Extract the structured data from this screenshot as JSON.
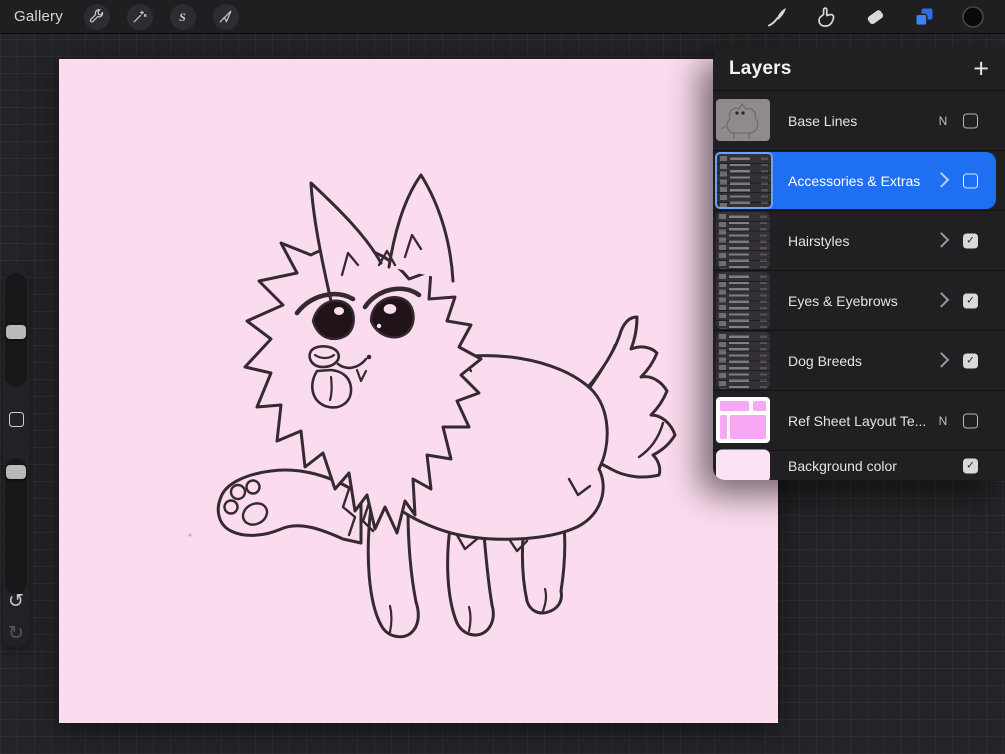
{
  "toolbar": {
    "gallery_label": "Gallery",
    "selection_glyph": "S",
    "icons_left": [
      "wrench-icon",
      "magic-wand-icon",
      "selection-icon",
      "transform-icon"
    ],
    "icons_right": [
      "brush-icon",
      "smudge-icon",
      "eraser-icon",
      "layers-icon",
      "color-swatch"
    ],
    "layers_icon_active_color": "#3c82f8",
    "color_swatch_color": "#0a0a0a"
  },
  "side_controls": {
    "undo_glyph": "↺",
    "redo_glyph": "↻"
  },
  "layers_panel": {
    "title": "Layers",
    "add_button_glyph": "+",
    "selection_color": "#1f6ff2",
    "rows": [
      {
        "label": "Base Lines",
        "badge": "N",
        "visible": false,
        "selected": false,
        "kind": "layer"
      },
      {
        "label": "Accessories & Extras",
        "visible": false,
        "selected": true,
        "kind": "group"
      },
      {
        "label": "Hairstyles",
        "visible": true,
        "selected": false,
        "kind": "group"
      },
      {
        "label": "Eyes & Eyebrows",
        "visible": true,
        "selected": false,
        "kind": "group"
      },
      {
        "label": "Dog Breeds",
        "visible": true,
        "selected": false,
        "kind": "group"
      },
      {
        "label": "Ref Sheet Layout Te...",
        "badge": "N",
        "visible": false,
        "selected": false,
        "kind": "layer"
      },
      {
        "label": "Background color",
        "visible": true,
        "selected": false,
        "kind": "background"
      }
    ]
  },
  "canvas": {
    "background_color": "#fbdcee",
    "line_color": "#352a30",
    "artwork": "chibi-dog-line-art"
  }
}
